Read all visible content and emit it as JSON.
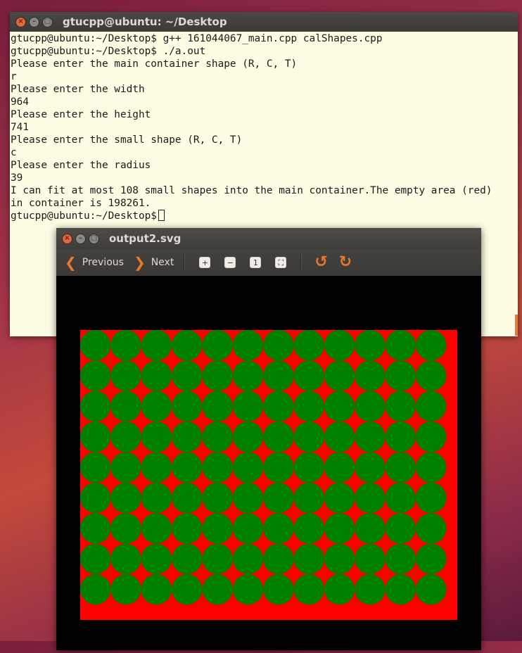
{
  "terminal": {
    "title": "gtucpp@ubuntu: ~/Desktop",
    "lines": [
      "gtucpp@ubuntu:~/Desktop$ g++ 161044067_main.cpp calShapes.cpp",
      "gtucpp@ubuntu:~/Desktop$ ./a.out",
      "Please enter the main container shape (R, C, T)",
      "r",
      "Please enter the width",
      "964",
      "Please enter the height",
      "741",
      "Please enter the small shape (R, C, T)",
      "c",
      "Please enter the radius",
      "39",
      "I can fit at most 108 small shapes into the main container.The empty area (red)",
      "in container is 198261."
    ],
    "prompt": "gtucpp@ubuntu:~/Desktop$ "
  },
  "viewer": {
    "title": "output2.svg",
    "toolbar": {
      "previous_label": "Previous",
      "next_label": "Next"
    },
    "image": {
      "container_color": "#ff0000",
      "shape_color": "#008000",
      "background_color": "#000000",
      "container_width": 964,
      "container_height": 741,
      "radius": 39,
      "columns": 12,
      "rows": 9
    }
  },
  "icons": {
    "close": "close-icon",
    "minimize": "minimize-icon",
    "maximize": "maximize-icon",
    "previous": "chevron-left-icon",
    "next": "chevron-right-icon",
    "zoom_in": "zoom-in-icon",
    "zoom_out": "zoom-out-icon",
    "zoom_normal": "zoom-normal-icon",
    "best_fit": "best-fit-icon",
    "rotate_left": "rotate-left-icon",
    "rotate_right": "rotate-right-icon"
  }
}
